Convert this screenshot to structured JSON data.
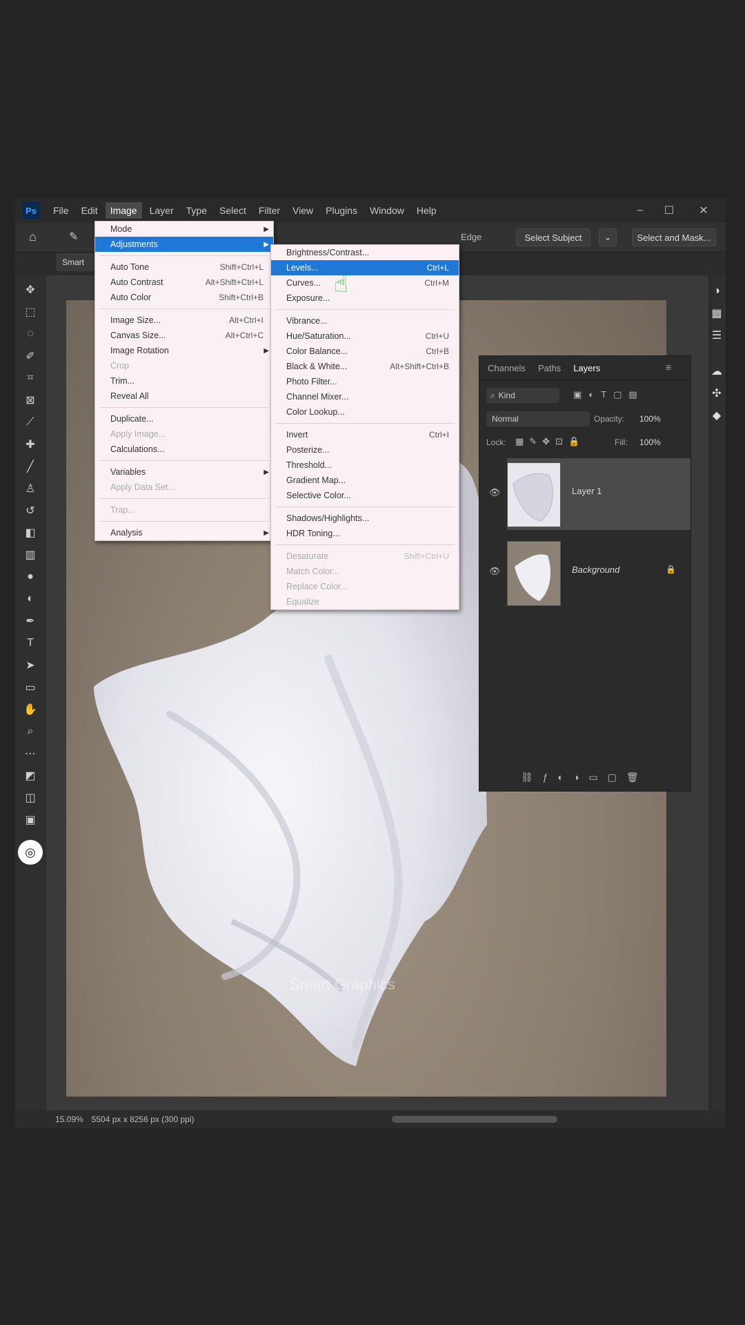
{
  "menubar": {
    "items": [
      "File",
      "Edit",
      "Image",
      "Layer",
      "Type",
      "Select",
      "Filter",
      "View",
      "Plugins",
      "Window",
      "Help"
    ],
    "active_index": 2,
    "logo": "Ps"
  },
  "window_controls": {
    "minimize": "–",
    "maximize": "☐",
    "close": "✕"
  },
  "options_bar": {
    "select_subject": "Select Subject",
    "select_and_mask": "Select and Mask...",
    "edge_label": "Edge"
  },
  "document_tab": {
    "title": "Smart"
  },
  "image_menu": {
    "items": [
      {
        "label": "Mode",
        "shortcut": "",
        "submenu": true,
        "disabled": false
      },
      {
        "label": "Adjustments",
        "shortcut": "",
        "submenu": true,
        "disabled": false,
        "highlighted": true
      },
      {
        "sep": true
      },
      {
        "label": "Auto Tone",
        "shortcut": "Shift+Ctrl+L"
      },
      {
        "label": "Auto Contrast",
        "shortcut": "Alt+Shift+Ctrl+L"
      },
      {
        "label": "Auto Color",
        "shortcut": "Shift+Ctrl+B"
      },
      {
        "sep": true
      },
      {
        "label": "Image Size...",
        "shortcut": "Alt+Ctrl+I"
      },
      {
        "label": "Canvas Size...",
        "shortcut": "Alt+Ctrl+C"
      },
      {
        "label": "Image Rotation",
        "shortcut": "",
        "submenu": true
      },
      {
        "label": "Crop",
        "shortcut": "",
        "disabled": true
      },
      {
        "label": "Trim...",
        "shortcut": ""
      },
      {
        "label": "Reveal All",
        "shortcut": ""
      },
      {
        "sep": true
      },
      {
        "label": "Duplicate...",
        "shortcut": ""
      },
      {
        "label": "Apply Image...",
        "shortcut": "",
        "disabled": true
      },
      {
        "label": "Calculations...",
        "shortcut": ""
      },
      {
        "sep": true
      },
      {
        "label": "Variables",
        "shortcut": "",
        "submenu": true
      },
      {
        "label": "Apply Data Set...",
        "shortcut": "",
        "disabled": true
      },
      {
        "sep": true
      },
      {
        "label": "Trap...",
        "shortcut": "",
        "disabled": true
      },
      {
        "sep": true
      },
      {
        "label": "Analysis",
        "shortcut": "",
        "submenu": true
      }
    ]
  },
  "adjustments_menu": {
    "items": [
      {
        "label": "Brightness/Contrast...",
        "shortcut": ""
      },
      {
        "label": "Levels...",
        "shortcut": "Ctrl+L",
        "highlighted": true
      },
      {
        "label": "Curves...",
        "shortcut": "Ctrl+M"
      },
      {
        "label": "Exposure...",
        "shortcut": ""
      },
      {
        "sep": true
      },
      {
        "label": "Vibrance...",
        "shortcut": ""
      },
      {
        "label": "Hue/Saturation...",
        "shortcut": "Ctrl+U"
      },
      {
        "label": "Color Balance...",
        "shortcut": "Ctrl+B"
      },
      {
        "label": "Black & White...",
        "shortcut": "Alt+Shift+Ctrl+B"
      },
      {
        "label": "Photo Filter...",
        "shortcut": ""
      },
      {
        "label": "Channel Mixer...",
        "shortcut": ""
      },
      {
        "label": "Color Lookup...",
        "shortcut": ""
      },
      {
        "sep": true
      },
      {
        "label": "Invert",
        "shortcut": "Ctrl+I"
      },
      {
        "label": "Posterize...",
        "shortcut": ""
      },
      {
        "label": "Threshold...",
        "shortcut": ""
      },
      {
        "label": "Gradient Map...",
        "shortcut": ""
      },
      {
        "label": "Selective Color...",
        "shortcut": ""
      },
      {
        "sep": true
      },
      {
        "label": "Shadows/Highlights...",
        "shortcut": ""
      },
      {
        "label": "HDR Toning...",
        "shortcut": ""
      },
      {
        "sep": true
      },
      {
        "label": "Desaturate",
        "shortcut": "Shift+Ctrl+U",
        "disabled": true
      },
      {
        "label": "Match Color...",
        "shortcut": "",
        "disabled": true
      },
      {
        "label": "Replace Color...",
        "shortcut": "",
        "disabled": true
      },
      {
        "label": "Equalize",
        "shortcut": "",
        "disabled": true
      }
    ]
  },
  "layers_panel": {
    "tabs": [
      "Channels",
      "Paths",
      "Layers"
    ],
    "active_tab": 2,
    "filter_kind": "Kind",
    "blend_mode": "Normal",
    "opacity_label": "Opacity:",
    "opacity_value": "100%",
    "lock_label": "Lock:",
    "fill_label": "Fill:",
    "fill_value": "100%",
    "layers": [
      {
        "name": "Layer 1",
        "selected": true,
        "visible": true
      },
      {
        "name": "Background",
        "selected": false,
        "visible": true,
        "locked": true
      }
    ]
  },
  "status_bar": {
    "zoom": "15.09%",
    "doc_info": "5504 px x 8256 px (300 ppi)"
  },
  "watermark": "Smart Graphics",
  "colors": {
    "menu_bg": "#fbf1f5",
    "highlight": "#1f78d6",
    "cursor": "#2fc443"
  }
}
